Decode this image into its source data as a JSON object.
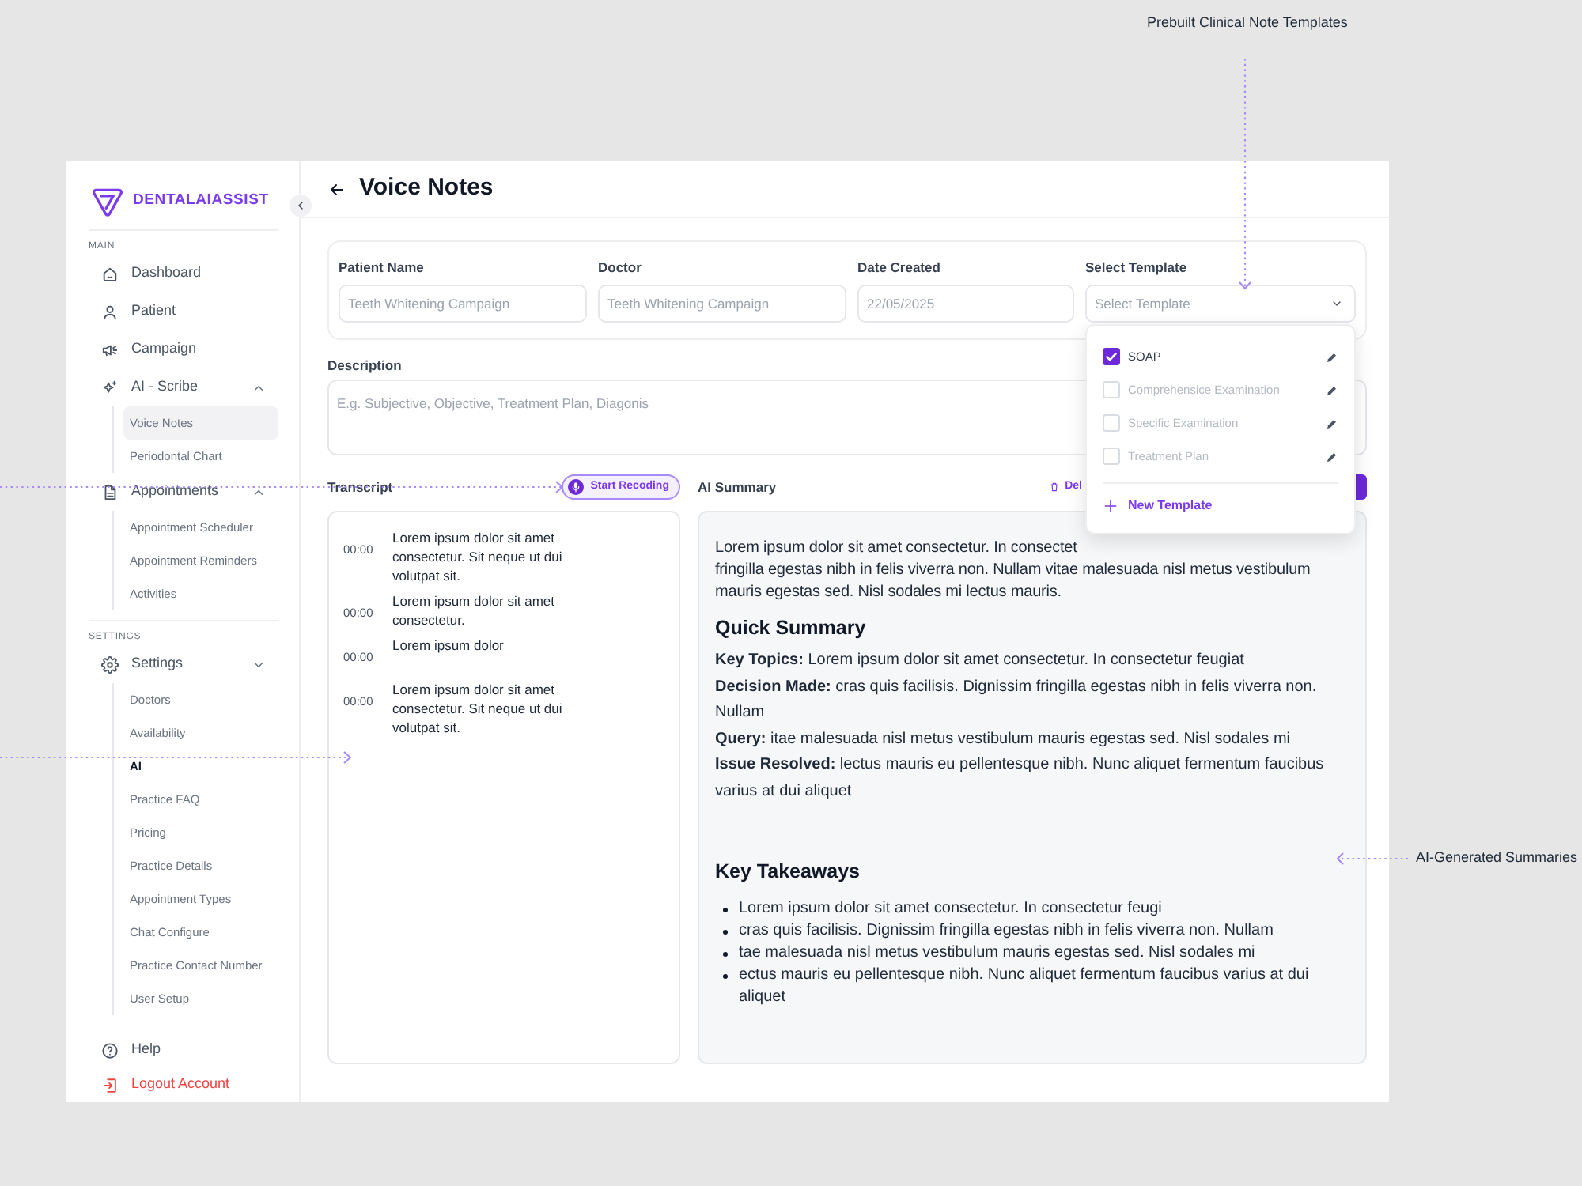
{
  "sidebar": {
    "logo": "DENTALAIASSIST",
    "sections": [
      {
        "heading": "MAIN",
        "items": [
          {
            "label": "Dashboard"
          },
          {
            "label": "Patient"
          },
          {
            "label": "Campaign"
          },
          {
            "label": "AI - Scribe",
            "expanded": true,
            "children": [
              {
                "label": "Voice Notes",
                "selected": true,
                "emphasized": false
              },
              {
                "label": "Periodontal Chart",
                "selected": false,
                "emphasized": false
              }
            ]
          },
          {
            "label": "Appointments",
            "expanded": true,
            "children": [
              {
                "label": "Appointment Scheduler",
                "selected": false,
                "emphasized": false
              },
              {
                "label": "Appointment Reminders",
                "selected": false,
                "emphasized": false
              },
              {
                "label": "Activities",
                "selected": false,
                "emphasized": false
              }
            ]
          }
        ]
      },
      {
        "heading": "SETTINGS",
        "items": [
          {
            "label": "Settings",
            "expanded": false,
            "children": [
              {
                "label": "Doctors",
                "selected": false,
                "emphasized": false
              },
              {
                "label": "Availability",
                "selected": false,
                "emphasized": false
              },
              {
                "label": "AI",
                "selected": false,
                "emphasized": true
              },
              {
                "label": "Practice FAQ",
                "selected": false,
                "emphasized": false
              },
              {
                "label": "Pricing",
                "selected": false,
                "emphasized": false
              },
              {
                "label": "Practice Details",
                "selected": false,
                "emphasized": false
              },
              {
                "label": "Appointment Types",
                "selected": false,
                "emphasized": false
              },
              {
                "label": "Chat Configure",
                "selected": false,
                "emphasized": false
              },
              {
                "label": "Practice Contact Number",
                "selected": false,
                "emphasized": false
              },
              {
                "label": "User Setup",
                "selected": false,
                "emphasized": false
              }
            ]
          }
        ]
      }
    ],
    "footer": [
      {
        "label": "Help",
        "kind": "normal"
      },
      {
        "label": "Logout Account",
        "kind": "danger"
      }
    ]
  },
  "header": {
    "title": "Voice Notes"
  },
  "form": {
    "fields": [
      {
        "kind": "text",
        "label": "Patient Name",
        "placeholder": "Teeth Whitening Campaign"
      },
      {
        "kind": "text",
        "label": "Doctor",
        "placeholder": "Teeth Whitening Campaign"
      },
      {
        "kind": "text",
        "label": "Date Created",
        "placeholder": "22/05/2025"
      },
      {
        "kind": "select",
        "label": "Select Template",
        "placeholder": "Select Template",
        "expanded": true,
        "options": [
          {
            "label": "SOAP",
            "checked": true
          },
          {
            "label": "Comprehensice Examination",
            "checked": false
          },
          {
            "label": "Specific Examination",
            "checked": false
          },
          {
            "label": "Treatment Plan",
            "checked": false
          }
        ],
        "add_option": "New Template"
      }
    ],
    "description": {
      "label": "Description",
      "placeholder": "E.g. Subjective, Objective, Treatment Plan, Diagonis"
    }
  },
  "transcript": {
    "title": "Transcript",
    "record_button": "Start Recoding",
    "entries": [
      {
        "time": "00:00",
        "text": "Lorem ipsum dolor sit amet consectetur. Sit neque ut dui volutpat sit."
      },
      {
        "time": "00:00",
        "text": "Lorem ipsum dolor sit amet consectetur."
      },
      {
        "time": "00:00",
        "text": "Lorem ipsum dolor"
      },
      {
        "time": "00:00",
        "text": "Lorem ipsum dolor sit amet consectetur. Sit neque ut dui volutpat sit."
      }
    ]
  },
  "summary": {
    "title": "AI Summary",
    "delete_button": "Del",
    "intro": "Lorem ipsum dolor sit amet consectetur. In consectet\nfringilla egestas nibh in felis viverra non. Nullam vitae malesuada nisl metus vestibulum\nmauris egestas sed. Nisl sodales mi lectus mauris.",
    "sections": [
      {
        "kind": "facts",
        "heading": "Quick Summary",
        "items": [
          "**Key Topics:** Lorem ipsum dolor sit amet consectetur. In consectetur feugiat",
          "**Decision Made:** cras quis facilisis. Dignissim fringilla egestas nibh in felis viverra non. Nullam",
          "**Query:** itae malesuada nisl metus vestibulum mauris egestas sed. Nisl sodales mi",
          "**Issue Resolved:** lectus mauris eu pellentesque nibh. Nunc aliquet fermentum faucibus varius at dui aliquet"
        ]
      },
      {
        "kind": "bullets",
        "heading": "Key Takeaways",
        "items": [
          "Lorem ipsum dolor sit amet consectetur. In consectetur feugi",
          "cras quis facilisis. Dignissim fringilla egestas nibh in felis viverra non. Nullam",
          "tae malesuada nisl metus vestibulum mauris egestas sed. Nisl sodales mi",
          "ectus mauris eu pellentesque nibh. Nunc aliquet fermentum faucibus varius at dui aliquet"
        ]
      }
    ]
  },
  "annotations": [
    {
      "kind": "down",
      "label": "Prebuilt Clinical Note Templates"
    },
    {
      "kind": "left",
      "label": "AI-Generated Summaries"
    }
  ]
}
